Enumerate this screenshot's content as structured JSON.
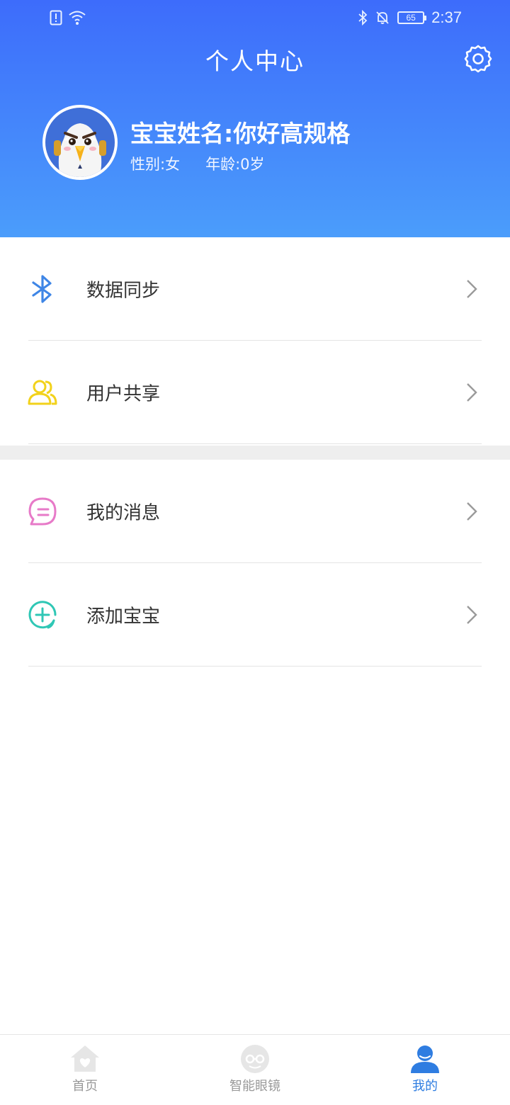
{
  "status_bar": {
    "time": "2:37",
    "battery": "65",
    "icons": [
      "sim-alert-icon",
      "wifi-icon",
      "bluetooth-icon",
      "bell-off-icon",
      "battery-icon"
    ]
  },
  "header": {
    "title": "个人中心",
    "settings_icon": "gear-icon"
  },
  "profile": {
    "name": "宝宝姓名:你好高规格",
    "gender": "性别:女",
    "age": "年龄:0岁"
  },
  "menu": {
    "group_1": [
      {
        "label": "数据同步",
        "icon": "bluetooth-icon",
        "color": "#3f86e6"
      },
      {
        "label": "用户共享",
        "icon": "users-icon",
        "color": "#f2d21b"
      }
    ],
    "group_2": [
      {
        "label": "我的消息",
        "icon": "message-icon",
        "color": "#e77ac8"
      },
      {
        "label": "添加宝宝",
        "icon": "add-circle-icon",
        "color": "#2fc7b5"
      }
    ]
  },
  "tab_bar": {
    "tabs": [
      {
        "label": "首页",
        "icon": "home-icon",
        "active": false
      },
      {
        "label": "智能眼镜",
        "icon": "glasses-icon",
        "active": false
      },
      {
        "label": "我的",
        "icon": "profile-icon",
        "active": true
      }
    ]
  },
  "colors": {
    "header_top": "#3d6cfb",
    "header_bottom": "#4b9dfb",
    "active_tab": "#2f7de1"
  }
}
